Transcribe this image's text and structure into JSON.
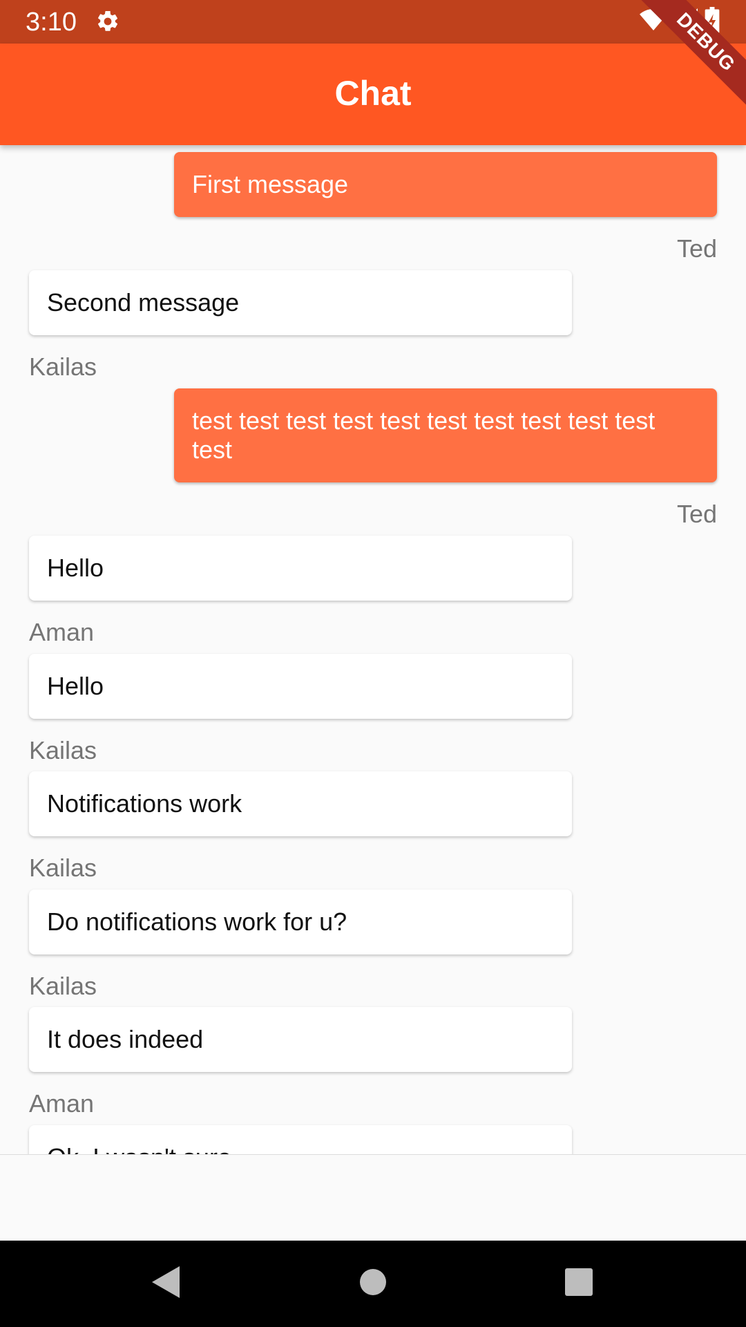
{
  "status_bar": {
    "time": "3:10",
    "icons": [
      "gear-icon",
      "wifi-icon",
      "signal-icon",
      "battery-icon"
    ],
    "background": "#bf411c"
  },
  "app_bar": {
    "title": "Chat",
    "background": "#ff5722"
  },
  "debug_banner": {
    "label": "DEBUG"
  },
  "messages": [
    {
      "text": "First message",
      "sender": "Ted",
      "mine": true
    },
    {
      "text": "Second message",
      "sender": "Kailas",
      "mine": false
    },
    {
      "text": "test test test test test test test test test test test",
      "sender": "Ted",
      "mine": true
    },
    {
      "text": "Hello",
      "sender": "Aman",
      "mine": false
    },
    {
      "text": "Hello",
      "sender": "Kailas",
      "mine": false
    },
    {
      "text": "Notifications work",
      "sender": "Kailas",
      "mine": false
    },
    {
      "text": "Do notifications work for u?",
      "sender": "Kailas",
      "mine": false
    },
    {
      "text": "It does indeed",
      "sender": "Aman",
      "mine": false
    },
    {
      "text": "Ok, I wasn't sure",
      "sender": "",
      "mine": false
    }
  ],
  "colors": {
    "my_bubble": "#ff7043",
    "their_bubble": "#ffffff",
    "sender_text": "#757575"
  },
  "nav_bar": {
    "icons": [
      "back-icon",
      "home-icon",
      "recents-icon"
    ]
  }
}
